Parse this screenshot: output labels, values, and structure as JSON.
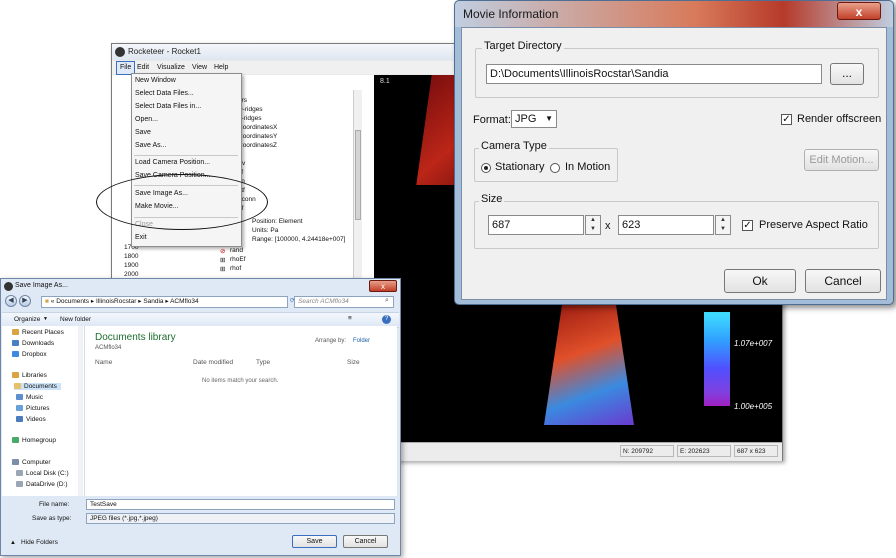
{
  "rocketeer": {
    "title": "Rocketeer - Rocket1",
    "menu": [
      "File",
      "Edit",
      "Visualize",
      "View",
      "Help"
    ],
    "tree_items": [
      "ers",
      "D-ridges",
      "2-ridges",
      "CoordinatesX",
      "CoordinatesY",
      "CoordinatesZ",
      "T",
      "Tv",
      "vf",
      "cn",
      "ctf",
      "nconn",
      "pf"
    ],
    "tree_details": [
      "Position: Element",
      "Units: Pa",
      "Range: [100000, 4.24418e+007]"
    ],
    "tree_items2": [
      "rand",
      "rhoEf",
      "rhof"
    ],
    "years": [
      "1700",
      "1800",
      "1900",
      "2000"
    ],
    "viewport_label": "8.1",
    "colorbar_labels": [
      "1.07e+007",
      "1.00e+005"
    ],
    "status": [
      "N: 209792",
      "E: 202623",
      "687 x 623"
    ]
  },
  "file_menu": {
    "items": [
      {
        "label": "New Window",
        "disabled": false
      },
      {
        "label": "Select Data Files...",
        "disabled": false
      },
      {
        "label": "Select Data Files in...",
        "disabled": false
      },
      {
        "label": "Open...",
        "disabled": false
      },
      {
        "label": "Save",
        "disabled": false
      },
      {
        "label": "Save As...",
        "disabled": false
      },
      {
        "label": "Load Camera Position...",
        "disabled": false
      },
      {
        "label": "Save Camera Position...",
        "disabled": false
      },
      {
        "label": "Save Image As...",
        "disabled": false
      },
      {
        "label": "Make Movie...",
        "disabled": false
      },
      {
        "label": "Close",
        "disabled": true
      },
      {
        "label": "Exit",
        "disabled": false
      }
    ]
  },
  "movie_info": {
    "title": "Movie Information",
    "close_glyph": "x",
    "target_dir_label": "Target Directory",
    "target_dir": "D:\\Documents\\IllinoisRocstar\\Sandia",
    "browse_label": "...",
    "format_label": "Format:",
    "format_value": "JPG",
    "render_offscreen_label": "Render offscreen",
    "render_offscreen": true,
    "camera_type_label": "Camera Type",
    "stationary_label": "Stationary",
    "in_motion_label": "In Motion",
    "camera_type": "stationary",
    "edit_motion_label": "Edit Motion...",
    "size_label": "Size",
    "width": "687",
    "times": "x",
    "height": "623",
    "preserve_label": "Preserve Aspect Ratio",
    "preserve": true,
    "ok_label": "Ok",
    "cancel_label": "Cancel",
    "colors": {
      "title_red": "#b63a2a",
      "frame_blue": "#a3bcd8"
    }
  },
  "save_image": {
    "title": "Save Image As...",
    "close_glyph": "x",
    "address": [
      "Documents",
      "IllinoisRocstar",
      "Sandia",
      "ACMflo34"
    ],
    "search_placeholder": "Search ACMflo34",
    "organize_label": "Organize",
    "new_folder_label": "New folder",
    "nav_items": [
      {
        "label": "Recent Places",
        "color": "#d9a441"
      },
      {
        "label": "Downloads",
        "color": "#4a7fc1"
      },
      {
        "label": "Dropbox",
        "color": "#3d8ae0"
      },
      {
        "label": "Libraries",
        "color": "#d9a441"
      },
      {
        "label": "Documents",
        "color": "#e5c16a"
      },
      {
        "label": "Music",
        "color": "#5b8fd0"
      },
      {
        "label": "Pictures",
        "color": "#6aa0d8"
      },
      {
        "label": "Videos",
        "color": "#4b7cc0"
      },
      {
        "label": "Homegroup",
        "color": "#4aa86a"
      },
      {
        "label": "Computer",
        "color": "#7b8ea8"
      },
      {
        "label": "Local Disk (C:)",
        "color": "#9aa6b6"
      },
      {
        "label": "DataDrive (D:)",
        "color": "#9aa6b6"
      }
    ],
    "library_title": "Documents library",
    "library_subtitle": "ACMflo34",
    "arrange_label": "Arrange by:",
    "arrange_value": "Folder",
    "columns": [
      "Name",
      "Date modified",
      "Type",
      "Size"
    ],
    "empty_text": "No items match your search.",
    "file_name_label": "File name:",
    "file_name": "TestSave",
    "save_type_label": "Save as type:",
    "save_type": "JPEG files (*.jpg,*.jpeg)",
    "hide_folders_label": "Hide Folders",
    "save_label": "Save",
    "cancel_label": "Cancel"
  }
}
